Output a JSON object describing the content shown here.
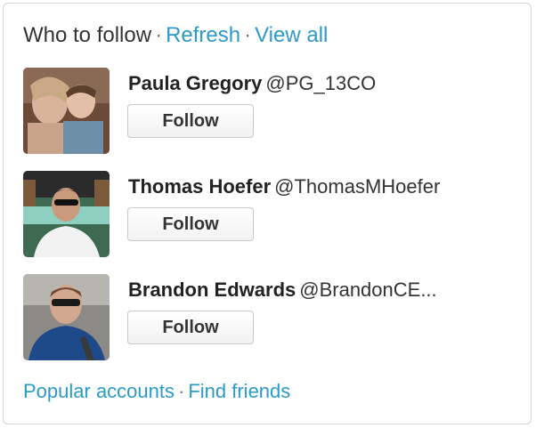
{
  "widget": {
    "title": "Who to follow",
    "separator": "·",
    "refresh_label": "Refresh",
    "view_all_label": "View all"
  },
  "suggestions": [
    {
      "name": "Paula Gregory",
      "handle": "@PG_13CO",
      "follow_label": "Follow"
    },
    {
      "name": "Thomas Hoefer",
      "handle": "@ThomasMHoefer",
      "follow_label": "Follow"
    },
    {
      "name": "Brandon Edwards",
      "handle": "@BrandonCE...",
      "follow_label": "Follow"
    }
  ],
  "footer": {
    "popular_label": "Popular accounts",
    "separator": "·",
    "find_friends_label": "Find friends"
  },
  "colors": {
    "link": "#2b9ac9",
    "text": "#333333",
    "border": "#d5d5d5"
  }
}
